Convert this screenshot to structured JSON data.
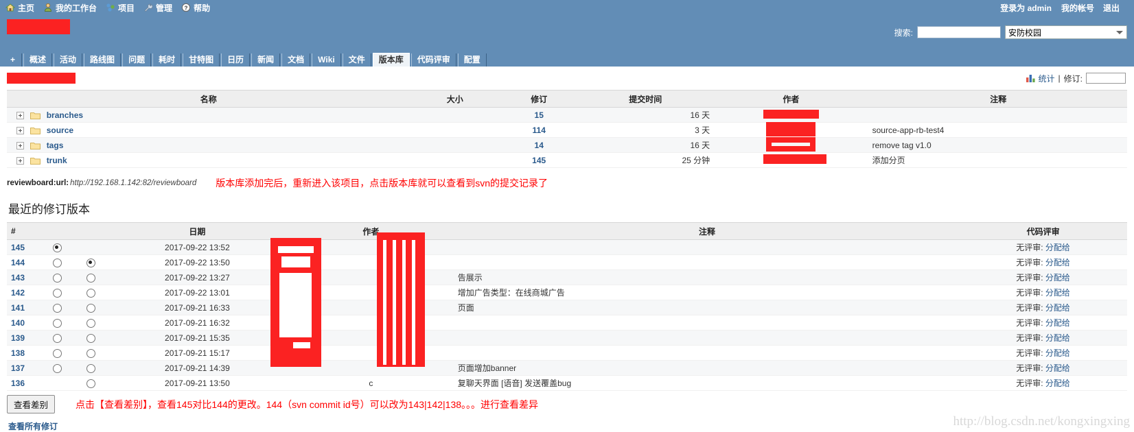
{
  "topnav": {
    "items": [
      {
        "label": "主页",
        "icon": "home-icon"
      },
      {
        "label": "我的工作台",
        "icon": "user-icon"
      },
      {
        "label": "项目",
        "icon": "projects-icon"
      },
      {
        "label": "管理",
        "icon": "wrench-icon"
      },
      {
        "label": "帮助",
        "icon": "help-icon"
      }
    ],
    "logged_in_as": "登录为 admin",
    "account": "我的帐号",
    "logout": "退出"
  },
  "search": {
    "label": "搜索:",
    "value": "",
    "placeholder": "",
    "project_selected": "安防校园"
  },
  "tabs": {
    "add_label": "+",
    "items": [
      {
        "label": "概述",
        "active": false
      },
      {
        "label": "活动",
        "active": false
      },
      {
        "label": "路线图",
        "active": false
      },
      {
        "label": "问题",
        "active": false
      },
      {
        "label": "耗时",
        "active": false
      },
      {
        "label": "甘特图",
        "active": false
      },
      {
        "label": "日历",
        "active": false
      },
      {
        "label": "新闻",
        "active": false
      },
      {
        "label": "文档",
        "active": false
      },
      {
        "label": "Wiki",
        "active": false
      },
      {
        "label": "文件",
        "active": false
      },
      {
        "label": "版本库",
        "active": true
      },
      {
        "label": "代码评审",
        "active": false
      },
      {
        "label": "配置",
        "active": false
      }
    ]
  },
  "repository": {
    "title_redacted": "",
    "stats_label": "统计",
    "separator": "|",
    "revision_label": "修订:",
    "revision_value": "",
    "columns": [
      "名称",
      "大小",
      "修订",
      "提交时间",
      "作者",
      "注释"
    ],
    "rows": [
      {
        "name": "branches",
        "size": "",
        "revision": "15",
        "time": "16 天",
        "author": "",
        "comment": ""
      },
      {
        "name": "source",
        "size": "",
        "revision": "114",
        "time": "3 天",
        "author": "",
        "comment": "source-app-rb-test4"
      },
      {
        "name": "tags",
        "size": "",
        "revision": "14",
        "time": "16 天",
        "author": "",
        "comment": "remove tag v1.0"
      },
      {
        "name": "trunk",
        "size": "",
        "revision": "145",
        "time": "25 分钟",
        "author": "",
        "comment": "添加分页"
      }
    ]
  },
  "reviewboard": {
    "key": "reviewboard:url:",
    "value": "http://192.168.1.142:82/reviewboard",
    "annotation": "版本库添加完后，重新进入该项目，点击版本库就可以查看到svn的提交记录了"
  },
  "revisions": {
    "heading": "最近的修订版本",
    "columns": [
      "#",
      "日期",
      "作者",
      "注释",
      "代码评审"
    ],
    "review_none_label": "无评审:",
    "review_assign_label": "分配给",
    "rows": [
      {
        "num": "145",
        "radio_a": true,
        "radio_b": false,
        "radio_a_visible": true,
        "radio_b_visible": false,
        "date": "2017-09-22 13:52",
        "author": "",
        "comment": ""
      },
      {
        "num": "144",
        "radio_a": false,
        "radio_b": true,
        "radio_a_visible": true,
        "radio_b_visible": true,
        "date": "2017-09-22 13:50",
        "author": "",
        "comment": ""
      },
      {
        "num": "143",
        "radio_a": false,
        "radio_b": false,
        "radio_a_visible": true,
        "radio_b_visible": true,
        "date": "2017-09-22 13:27",
        "author": "",
        "comment": "告展示"
      },
      {
        "num": "142",
        "radio_a": false,
        "radio_b": false,
        "radio_a_visible": true,
        "radio_b_visible": true,
        "date": "2017-09-22 13:01",
        "author": "",
        "comment": "增加广告类型：在线商城广告"
      },
      {
        "num": "141",
        "radio_a": false,
        "radio_b": false,
        "radio_a_visible": true,
        "radio_b_visible": true,
        "date": "2017-09-21 16:33",
        "author": "",
        "comment": "页面"
      },
      {
        "num": "140",
        "radio_a": false,
        "radio_b": false,
        "radio_a_visible": true,
        "radio_b_visible": true,
        "date": "2017-09-21 16:32",
        "author": "",
        "comment": ""
      },
      {
        "num": "139",
        "radio_a": false,
        "radio_b": false,
        "radio_a_visible": true,
        "radio_b_visible": true,
        "date": "2017-09-21 15:35",
        "author": "",
        "comment": ""
      },
      {
        "num": "138",
        "radio_a": false,
        "radio_b": false,
        "radio_a_visible": true,
        "radio_b_visible": true,
        "date": "2017-09-21 15:17",
        "author": "",
        "comment": ""
      },
      {
        "num": "137",
        "radio_a": false,
        "radio_b": false,
        "radio_a_visible": true,
        "radio_b_visible": true,
        "date": "2017-09-21 14:39",
        "author": "",
        "comment": "页面增加banner"
      },
      {
        "num": "136",
        "radio_a": false,
        "radio_b": false,
        "radio_a_visible": false,
        "radio_b_visible": true,
        "date": "2017-09-21 13:50",
        "author": "c",
        "comment": "复聊天界面 [语音] 发送覆盖bug"
      }
    ]
  },
  "bottom": {
    "diff_button": "查看差别",
    "annotation": "点击【查看差别】，查看145对比144的更改。144（svn commit id号）可以改为143|142|138。。。进行查看差异",
    "all_revisions": "查看所有修订"
  },
  "watermark": "http://blog.csdn.net/kongxingxing",
  "colors": {
    "header_blue": "#628db6",
    "link_blue": "#2a5a8c",
    "redaction_red": "#fb2222",
    "annotation_red": "#ff0000"
  }
}
